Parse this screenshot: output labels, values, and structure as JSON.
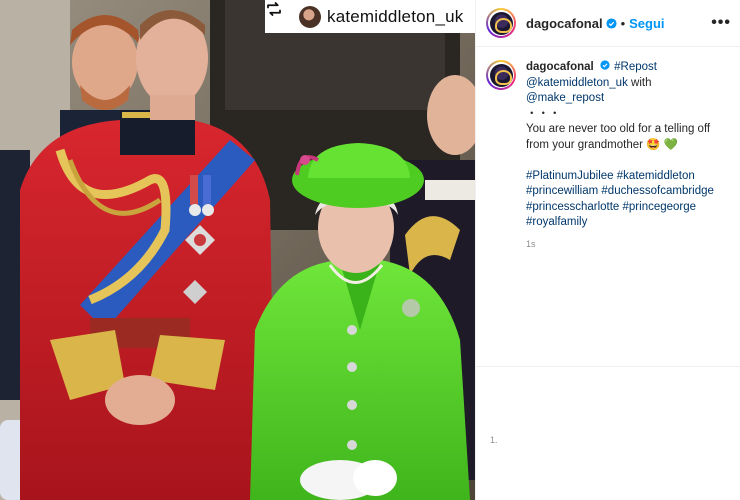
{
  "photo": {
    "description_icon": "repost-icon",
    "repost_account": "katemiddleton_uk"
  },
  "post": {
    "username": "dagocafonal",
    "separator": "•",
    "follow_label": "Segui",
    "more_label": "•••"
  },
  "caption": {
    "username": "dagocafonal",
    "line1_tag": "#Repost",
    "line2_mention": "@katemiddleton_uk",
    "line2_rest": " with",
    "line3_mention": "@make_repost",
    "dots": "・・・",
    "message": "You are never too old for a telling off from your grandmother",
    "emoji": "🤩 💚",
    "hashtags": "#PlatinumJubilee #katemiddleton #princewilliam #duchessofcambridge #princesscharlotte #princegeorge #royalfamily",
    "time": "1s"
  },
  "footer": {
    "mark": "1."
  },
  "colors": {
    "link": "#00376b",
    "follow": "#0095f6",
    "uniform_red": "#c8202a",
    "hat_green": "#55d424"
  }
}
